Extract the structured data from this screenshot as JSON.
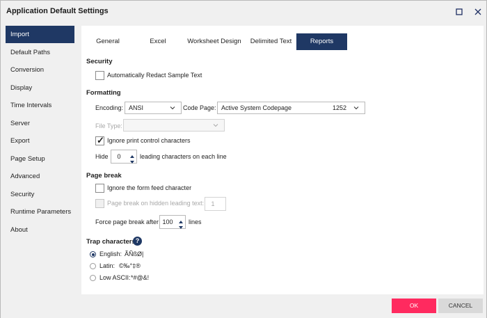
{
  "window": {
    "title": "Application Default Settings"
  },
  "sidebar": {
    "items": [
      {
        "label": "Import",
        "active": true
      },
      {
        "label": "Default Paths"
      },
      {
        "label": "Conversion"
      },
      {
        "label": "Display"
      },
      {
        "label": "Time Intervals"
      },
      {
        "label": "Server"
      },
      {
        "label": "Export"
      },
      {
        "label": "Page Setup"
      },
      {
        "label": "Advanced"
      },
      {
        "label": "Security"
      },
      {
        "label": "Runtime Parameters"
      },
      {
        "label": "About"
      }
    ]
  },
  "tabs": [
    {
      "label": "General"
    },
    {
      "label": "Excel"
    },
    {
      "label": "Worksheet Design"
    },
    {
      "label": "Delimited Text"
    },
    {
      "label": "Reports",
      "active": true
    }
  ],
  "security": {
    "heading": "Security",
    "redact_label": "Automatically Redact Sample Text",
    "redact_checked": false
  },
  "formatting": {
    "heading": "Formatting",
    "encoding_label": "Encoding:",
    "encoding_value": "ANSI",
    "codepage_label": "Code Page:",
    "codepage_value": "Active System Codepage",
    "codepage_number": "1252",
    "filetype_label": "File Type:",
    "filetype_value": "",
    "ignore_print_label": "Ignore print control characters",
    "ignore_print_checked": true,
    "hide_label": "Hide",
    "hide_value": "0",
    "hide_suffix": "leading characters on each line"
  },
  "page_break": {
    "heading": "Page break",
    "ignore_ff_label": "Ignore the form feed character",
    "ignore_ff_checked": false,
    "hidden_leading_label": "Page break on hidden leading text:",
    "hidden_leading_value": "1",
    "force_label": "Force page break after",
    "force_value": "100",
    "force_suffix": "lines"
  },
  "trap": {
    "heading": "Trap characters",
    "help_glyph": "?",
    "options": [
      {
        "label": "English:",
        "chars": "ÃÑßØ|",
        "selected": true
      },
      {
        "label": "Latin:",
        "chars": "©‰°‡®",
        "selected": false
      },
      {
        "label": "Low ASCII:",
        "chars": "*#@&!",
        "selected": false
      }
    ]
  },
  "footer": {
    "ok_label": "OK",
    "cancel_label": "CANCEL"
  },
  "colors": {
    "accent": "#1f3864",
    "ok_button": "#ff2a5f",
    "cancel_button": "#d9d9d9"
  }
}
